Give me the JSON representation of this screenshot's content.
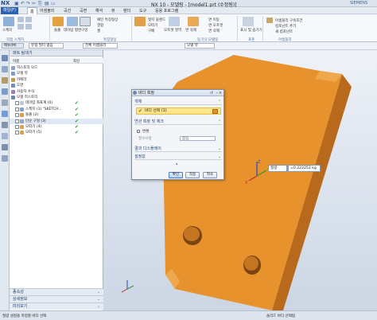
{
  "app": {
    "logo": "NX",
    "window_title": "NX 10 - 모델링 - [model1.prt (수정됨)]",
    "siemens": "SIEMENS"
  },
  "menubar": {
    "file": "파일(F)",
    "tabs": [
      "홈",
      "어셈블리",
      "곡선",
      "곡면",
      "해석",
      "뷰",
      "렌더",
      "도구",
      "응용 프로그램"
    ]
  },
  "ribbon": {
    "groups": [
      {
        "name": "직접 스케치",
        "buttons": [
          "스케치"
        ]
      },
      {
        "name": "특징형상",
        "buttons": [
          "돌출",
          "데이텀 평면",
          "구멍",
          "패턴 특징형상",
          "결합",
          "셸"
        ]
      },
      {
        "name": "동기식 모델링",
        "buttons": [
          "오프셋 영역",
          "면 삭제",
          "면 이동"
        ]
      },
      {
        "name": "표준",
        "buttons": [
          "표시 및 숨기기"
        ]
      },
      {
        "name": "어셈블리",
        "buttons": [
          "어셈블리 구속조건",
          "컴포넌트 추가",
          "새 컴포넌트"
        ]
      }
    ],
    "small_items": [
      "패턴 특징형상",
      "결합",
      "셸",
      "엣지 블렌드",
      "모따기",
      "구배",
      "면 이동",
      "면 오프셋",
      "면 삭제"
    ]
  },
  "toolbar2": {
    "menu": "메뉴(M)",
    "filter": "유형 필터 없음",
    "scope": "전체 어셈블리",
    "snap": "모델 뷰"
  },
  "navigator": {
    "title": "파트 탐색기",
    "columns": {
      "name": "이름",
      "latest": "최신"
    },
    "rows": [
      {
        "label": "히스토리 모드",
        "indent": 0,
        "latest": false
      },
      {
        "label": "모델 뷰",
        "indent": 0,
        "latest": false
      },
      {
        "label": "카메라",
        "indent": 0,
        "latest": false
      },
      {
        "label": "도면",
        "indent": 0,
        "latest": false
      },
      {
        "label": "사용자 수식",
        "indent": 0,
        "latest": false
      },
      {
        "label": "모델 히스토리",
        "indent": 0,
        "latest": false
      },
      {
        "label": "데이텀 좌표계 (0)",
        "indent": 1,
        "latest": true
      },
      {
        "label": "스케치 (1) \"SKETCH...",
        "indent": 1,
        "latest": true
      },
      {
        "label": "돌출 (2)",
        "indent": 1,
        "latest": true
      },
      {
        "label": "단순 구멍 (3)",
        "indent": 1,
        "latest": true
      },
      {
        "label": "모따기 (4)",
        "indent": 1,
        "latest": true
      },
      {
        "label": "모따기 (5)",
        "indent": 1,
        "latest": true
      }
    ],
    "panels": [
      "종속성",
      "상세정보",
      "미리보기"
    ]
  },
  "dialog": {
    "title": "바디 측정",
    "sections": {
      "object": "개체",
      "options": "연관 측정 및 체크",
      "display": "결과 디스플레이",
      "settings": "설정값"
    },
    "body_select": "바디 선택 (1)",
    "checkbox_label": "변환",
    "unit_label": "필수사항",
    "unit_value": "없음",
    "buttons": {
      "ok": "확인",
      "apply": "적용",
      "cancel": "취소"
    }
  },
  "measurement": {
    "type": "질량",
    "value": "=0.222252 kg"
  },
  "status": {
    "left": "질량 설정을 측정할 바디 선택",
    "right": "솔리드 바디 선택됨"
  },
  "colors": {
    "body": "#e8922e",
    "body_dark": "#b8681a",
    "highlight": "#fde58a",
    "accent": "#2a62b0"
  }
}
